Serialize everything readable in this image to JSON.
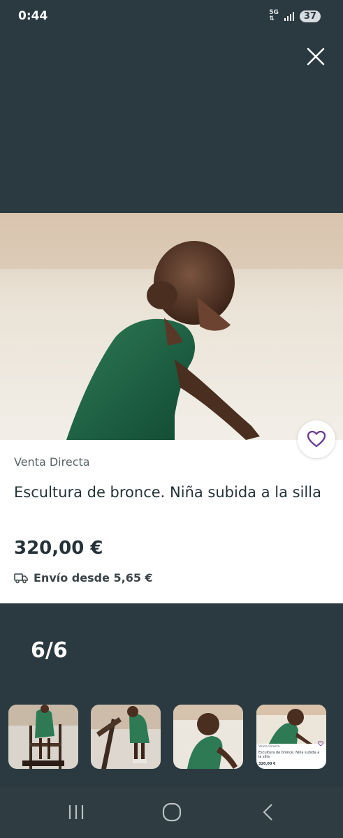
{
  "status_bar": {
    "time": "0:44",
    "network": "5G",
    "battery": "37"
  },
  "viewer": {
    "close_icon": "close-icon",
    "counter": "6/6",
    "background_color": "#2b3a40"
  },
  "listing": {
    "seller_type": "Venta Directa",
    "title": "Escultura de bronce. Niña subida a la silla",
    "price": "320,00 €",
    "shipping": "Envío desde 5,65 €",
    "favorite_icon": "heart-icon",
    "shipping_icon": "truck-icon",
    "accent_color": "#6a3c8c"
  },
  "thumbnails": {
    "items": [
      {
        "name": "thumbnail-1"
      },
      {
        "name": "thumbnail-2"
      },
      {
        "name": "thumbnail-3"
      },
      {
        "name": "thumbnail-4-selected",
        "mini_seller": "Venta Directa",
        "mini_title": "Escultura de bronce. Niña subida a la silla",
        "mini_price": "320,00 €"
      }
    ]
  },
  "nav_bar": {
    "recents_icon": "recents-icon",
    "home_icon": "home-icon",
    "back_icon": "back-icon"
  }
}
